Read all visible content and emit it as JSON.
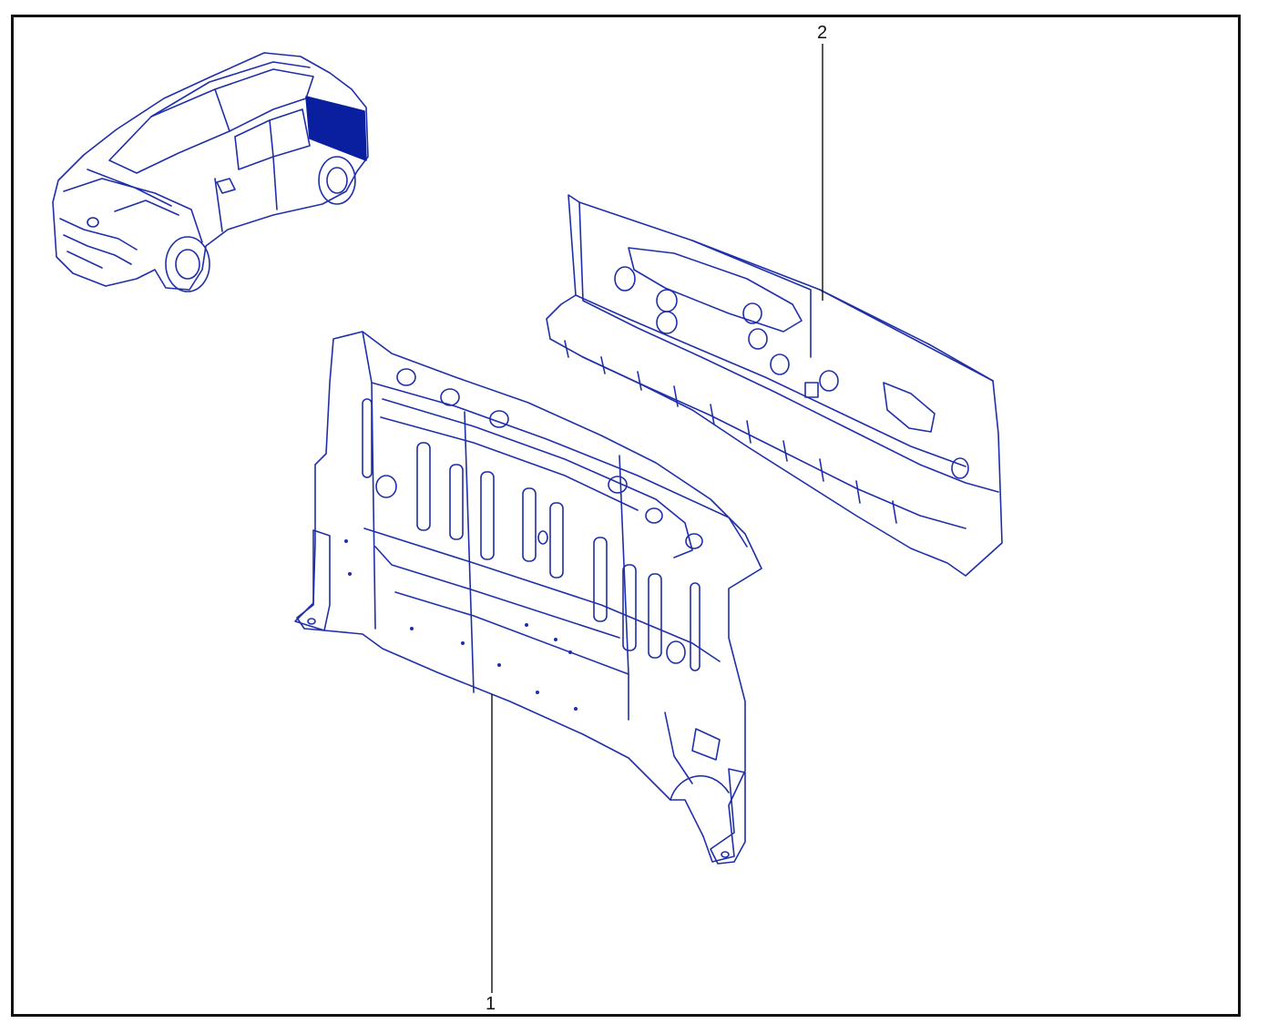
{
  "diagram": {
    "colors": {
      "line": "#1f2fa8",
      "highlight": "#0a1fa0",
      "frame": "#111111"
    },
    "callouts": [
      {
        "id": "1",
        "label": "1"
      },
      {
        "id": "2",
        "label": "2"
      }
    ]
  }
}
